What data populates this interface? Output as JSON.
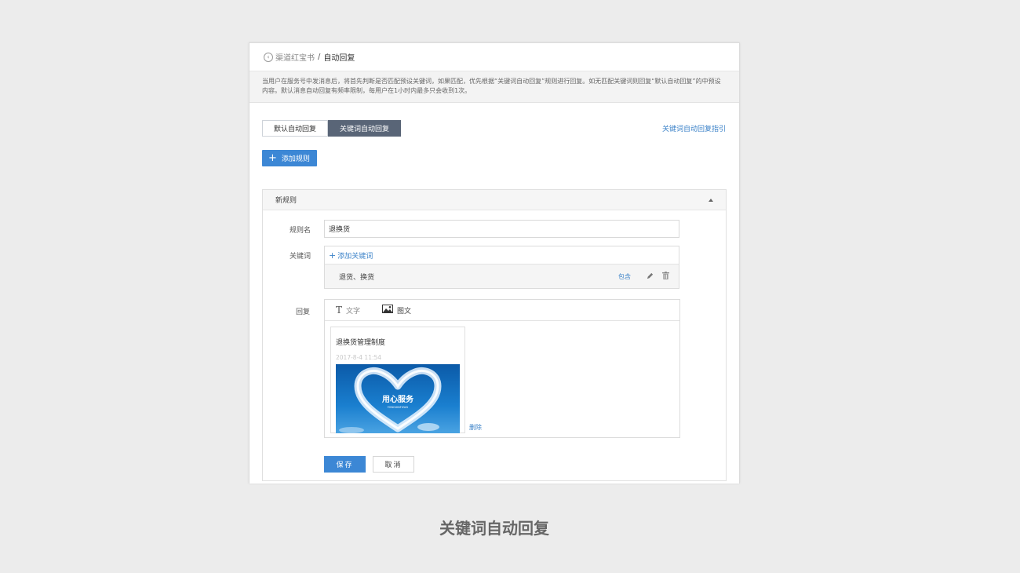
{
  "breadcrumb": {
    "parent": "渠道红宝书",
    "separator": "/",
    "current": "自动回复"
  },
  "notice": "当用户在服务号中发消息后，将首先判断是否匹配预设关键词，如果匹配，优先根据“关键词自动回复”规则进行回复。如无匹配关键词则回复“默认自动回复”的中预设内容。默认消息自动回复有频率限制，每用户在1小时内最多只会收到1次。",
  "tabs": [
    {
      "label": "默认自动回复",
      "active": false
    },
    {
      "label": "关键词自动回复",
      "active": true
    }
  ],
  "guide_link": "关键词自动回复指引",
  "add_rule_label": "添加规则",
  "rule": {
    "header": "新规则",
    "name_label": "规则名",
    "name_value": "退换货",
    "keyword_label": "关键词",
    "add_keyword_label": "添加关键词",
    "keywords": [
      {
        "text": "退货、换货",
        "match": "包含"
      }
    ],
    "reply_label": "回复",
    "reply_tabs": {
      "text": "文字",
      "news": "图文"
    },
    "news": {
      "title": "退换货管理制度",
      "date": "2017-8-4 11:54",
      "cover_title": "用心服务",
      "cover_subtitle": "YONGXINFUWU"
    },
    "delete_label": "删除",
    "save_label": "保存",
    "cancel_label": "取消"
  },
  "caption": "关键词自动回复",
  "colors": {
    "accent": "#3c87d5",
    "active_tab": "#596577",
    "link": "#3b82c8"
  }
}
